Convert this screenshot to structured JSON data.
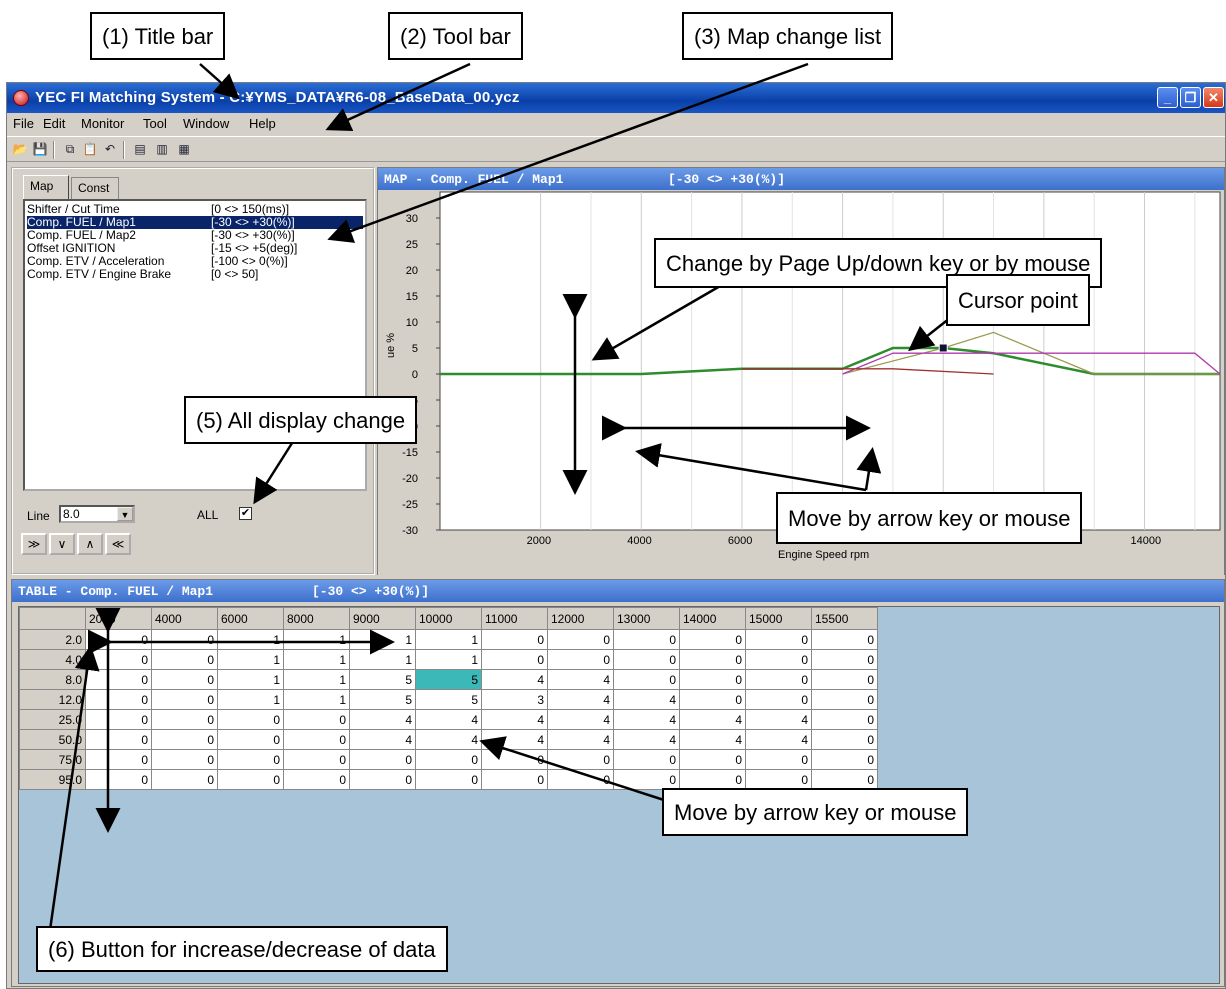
{
  "window": {
    "title": "YEC FI Matching System - C:¥YMS_DATA¥R6-08_BaseData_00.ycz"
  },
  "menu": [
    "File",
    "Edit",
    "Monitor",
    "Tool",
    "Window",
    "Help"
  ],
  "toolbar_icons": [
    "open-icon",
    "save-icon",
    "copy-icon",
    "paste-icon",
    "undo-icon",
    "ecu-read-icon",
    "ecu-write-icon",
    "table-icon"
  ],
  "left_panel": {
    "tabs": [
      "Map",
      "Const"
    ],
    "list": [
      {
        "name": "Shifter / Cut Time",
        "range": "[0 <> 150(ms)]"
      },
      {
        "name": "Comp. FUEL / Map1",
        "range": "[-30 <> +30(%)]"
      },
      {
        "name": "Comp. FUEL / Map2",
        "range": "[-30 <> +30(%)]"
      },
      {
        "name": "Offset IGNITION",
        "range": "[-15 <> +5(deg)]"
      },
      {
        "name": "Comp. ETV / Acceleration",
        "range": "[-100 <> 0(%)]"
      },
      {
        "name": "Comp. ETV / Engine Brake",
        "range": "[0 <> 50]"
      }
    ],
    "line_label": "Line",
    "line_value": "8.0",
    "all_label": "ALL",
    "all_checked": "✔",
    "adjust_buttons": [
      "≫",
      "∨",
      "∧",
      "≪"
    ]
  },
  "map_panel": {
    "title": "MAP - Comp. FUEL / Map1",
    "range": "[-30 <> +30(%)]",
    "chart_data": {
      "type": "line",
      "xlabel": "Engine Speed rpm",
      "ylabel": "ue %",
      "xlim": [
        0,
        15500
      ],
      "ylim": [
        -30,
        35
      ],
      "xticks": [
        2000,
        4000,
        6000,
        8000,
        10000,
        12000,
        14000
      ],
      "yticks": [
        30,
        25,
        20,
        15,
        10,
        5,
        0,
        -5,
        -10,
        -15,
        -20,
        -25,
        -30
      ],
      "series": [
        {
          "color": "#2e8b2e",
          "x": [
            0,
            4000,
            6000,
            8000,
            9000,
            10000,
            11000,
            13000,
            15500
          ],
          "y": [
            0,
            0,
            1,
            1,
            5,
            5,
            4,
            0,
            0
          ]
        },
        {
          "color": "#9a9a50",
          "x": [
            8000,
            10000,
            11000,
            13000,
            15500
          ],
          "y": [
            0,
            5,
            8,
            0,
            0
          ]
        },
        {
          "color": "#b03ab0",
          "x": [
            8000,
            9000,
            15000,
            15500
          ],
          "y": [
            0,
            4,
            4,
            0
          ]
        },
        {
          "color": "#a03030",
          "x": [
            6000,
            8000,
            9000,
            11000
          ],
          "y": [
            1,
            1,
            1,
            0
          ]
        }
      ],
      "cursor": {
        "x": 10000,
        "y": 5
      }
    }
  },
  "table_panel": {
    "title": "TABLE - Comp. FUEL / Map1",
    "range": "[-30 <> +30(%)]",
    "columns": [
      "2000",
      "4000",
      "6000",
      "8000",
      "9000",
      "10000",
      "11000",
      "12000",
      "13000",
      "14000",
      "15000",
      "15500"
    ],
    "rows": [
      {
        "label": "2.0",
        "values": [
          "0",
          "0",
          "1",
          "1",
          "1",
          "1",
          "0",
          "0",
          "0",
          "0",
          "0",
          "0"
        ]
      },
      {
        "label": "4.0",
        "values": [
          "0",
          "0",
          "1",
          "1",
          "1",
          "1",
          "0",
          "0",
          "0",
          "0",
          "0",
          "0"
        ]
      },
      {
        "label": "8.0",
        "values": [
          "0",
          "0",
          "1",
          "1",
          "5",
          "5",
          "4",
          "4",
          "0",
          "0",
          "0",
          "0"
        ]
      },
      {
        "label": "12.0",
        "values": [
          "0",
          "0",
          "1",
          "1",
          "5",
          "5",
          "3",
          "4",
          "4",
          "0",
          "0",
          "0"
        ]
      },
      {
        "label": "25.0",
        "values": [
          "0",
          "0",
          "0",
          "0",
          "4",
          "4",
          "4",
          "4",
          "4",
          "4",
          "4",
          "0"
        ]
      },
      {
        "label": "50.0",
        "values": [
          "0",
          "0",
          "0",
          "0",
          "4",
          "4",
          "4",
          "4",
          "4",
          "4",
          "4",
          "0"
        ]
      },
      {
        "label": "75.0",
        "values": [
          "0",
          "0",
          "0",
          "0",
          "0",
          "0",
          "0",
          "0",
          "0",
          "0",
          "0",
          "0"
        ]
      },
      {
        "label": "95.0",
        "values": [
          "0",
          "0",
          "0",
          "0",
          "0",
          "0",
          "0",
          "0",
          "0",
          "0",
          "0",
          "0"
        ]
      }
    ]
  },
  "callouts": {
    "title_bar": "(1) Title bar",
    "tool_bar": "(2) Tool bar",
    "map_change": "(3) Map change list",
    "page_updown": "Change by Page Up/down key or by mouse",
    "cursor_point": "Cursor point",
    "all_display": "(5) All display change",
    "move_arrow_map": "Move by arrow key or mouse",
    "move_arrow_table": "Move by arrow key or mouse",
    "inc_dec": "(6) Button for increase/decrease of data"
  }
}
